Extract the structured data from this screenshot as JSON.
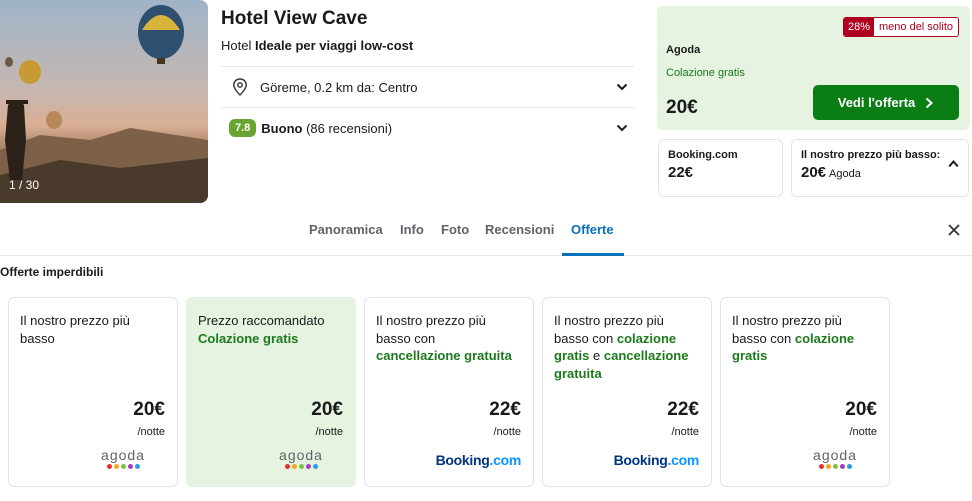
{
  "hotel": {
    "photo_counter": "1 / 30",
    "name": "Hotel View Cave",
    "subtitle_prefix": "Hotel",
    "subtitle_bold": "Ideale per viaggi low-cost",
    "location": "Göreme, 0.2 km da: Centro",
    "rating_score": "7.8",
    "rating_label": "Buono",
    "rating_reviews": "(86 recensioni)"
  },
  "main_offer": {
    "discount_pct": "28%",
    "discount_text": "meno del solito",
    "provider": "Agoda",
    "perk": "Colazione gratis",
    "price": "20€",
    "button_label": "Vedi l'offerta"
  },
  "other_offers": {
    "booking_label": "Booking.com",
    "booking_price": "22€",
    "lowest_label": "Il nostro prezzo più basso:",
    "lowest_price": "20€",
    "lowest_provider": "Agoda"
  },
  "tabs": [
    {
      "label": "Panoramica"
    },
    {
      "label": "Info"
    },
    {
      "label": "Foto"
    },
    {
      "label": "Recensioni"
    },
    {
      "label": "Offerte"
    }
  ],
  "active_tab": "Offerte",
  "deals_title": "Offerte imperdibili",
  "deals": [
    {
      "desc_plain": "Il nostro prezzo più basso",
      "price": "20€",
      "unit": "/notte",
      "logo": "agoda"
    },
    {
      "desc_plain": "Prezzo raccomandato",
      "desc_green": "Colazione gratis",
      "price": "20€",
      "unit": "/notte",
      "logo": "agoda"
    },
    {
      "desc_plain": "Il nostro prezzo più basso con",
      "desc_green": "cancellazione gratuita",
      "price": "22€",
      "unit": "/notte",
      "logo": "booking"
    },
    {
      "desc_plain": "Il nostro prezzo più basso con",
      "desc_green": "colazione gratis",
      "desc_mid": "e",
      "desc_green2": "cancellazione gratuita",
      "price": "22€",
      "unit": "/notte",
      "logo": "booking"
    },
    {
      "desc_plain": "Il nostro prezzo più basso con",
      "desc_green": "colazione gratis",
      "price": "20€",
      "unit": "/notte",
      "logo": "agoda"
    }
  ],
  "logos": {
    "agoda_text": "agoda",
    "booking_main": "Booking",
    "booking_suffix": ".com"
  },
  "colors": {
    "brand_green": "#0a7d14",
    "perk_green": "#1c7a1c",
    "highlight_bg": "#e6f3e1",
    "active_tab": "#0a6fb9",
    "discount_red": "#b00020",
    "rating_green": "#69a533",
    "agoda_dots": [
      "#e8302d",
      "#f5a623",
      "#7cc142",
      "#a53fbf",
      "#2b9de1"
    ]
  }
}
